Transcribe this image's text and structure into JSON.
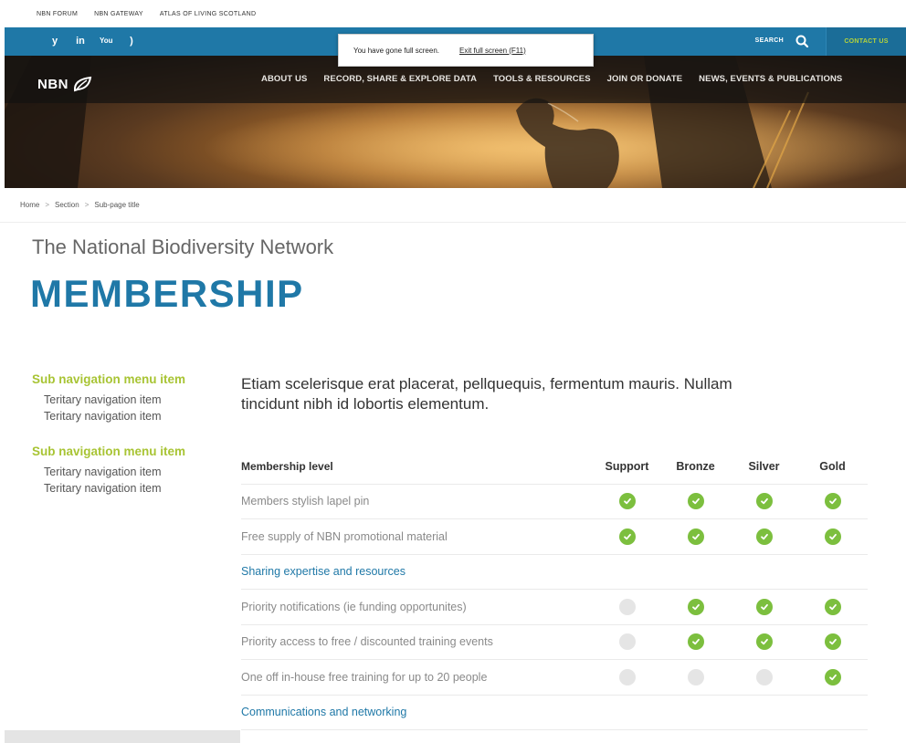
{
  "utility_links": [
    "NBN FORUM",
    "NBN GATEWAY",
    "ATLAS OF LIVING SCOTLAND"
  ],
  "social_icons": [
    "twitter-icon",
    "linkedin-icon",
    "youtube-icon",
    "rss-icon"
  ],
  "social_glyphs": [
    "y",
    "in",
    "You",
    ")"
  ],
  "search_label": "SEARCH",
  "contact_label": "CONTACT US",
  "fullscreen": {
    "message": "You have gone full screen.",
    "exit": "Exit full screen (F11)"
  },
  "logo": "NBN",
  "nav": [
    "ABOUT US",
    "RECORD, SHARE & EXPLORE DATA",
    "TOOLS & RESOURCES",
    "JOIN OR DONATE",
    "NEWS, EVENTS & PUBLICATIONS"
  ],
  "breadcrumb": [
    "Home",
    "Section",
    "Sub-page title"
  ],
  "breadcrumb_sep": ">",
  "subtitle": "The National Biodiversity Network",
  "title": "MEMBERSHIP",
  "subnav": [
    {
      "main": "Sub navigation menu item",
      "items": [
        "Teritary navigation item",
        "Teritary navigation item"
      ]
    },
    {
      "main": "Sub navigation menu item",
      "items": [
        "Teritary navigation item",
        "Teritary navigation item"
      ]
    }
  ],
  "intro": "Etiam scelerisque erat placerat, pellquequis, fermentum mauris. Nullam tincidunt nibh id lobortis elementum.",
  "table": {
    "header": {
      "label": "Membership level",
      "levels": [
        "Support",
        "Bronze",
        "Silver",
        "Gold"
      ]
    },
    "rows": [
      {
        "type": "feature",
        "label": "Members stylish lapel pin",
        "values": [
          true,
          true,
          true,
          true
        ]
      },
      {
        "type": "feature",
        "label": "Free supply of NBN promotional material",
        "values": [
          true,
          true,
          true,
          true
        ]
      },
      {
        "type": "section",
        "label": "Sharing expertise and resources"
      },
      {
        "type": "feature",
        "label": "Priority notifications (ie funding opportunites)",
        "values": [
          false,
          true,
          true,
          true
        ]
      },
      {
        "type": "feature",
        "label": "Priority access to free / discounted training events",
        "values": [
          false,
          true,
          true,
          true
        ]
      },
      {
        "type": "feature",
        "label": "One off in-house free training for up to 20 people",
        "values": [
          false,
          false,
          false,
          true
        ]
      },
      {
        "type": "section",
        "label": "Communications and networking"
      }
    ]
  },
  "colors": {
    "brand_blue": "#1f78a7",
    "accent_green": "#a8c434",
    "tick_green": "#7cbf3e"
  }
}
